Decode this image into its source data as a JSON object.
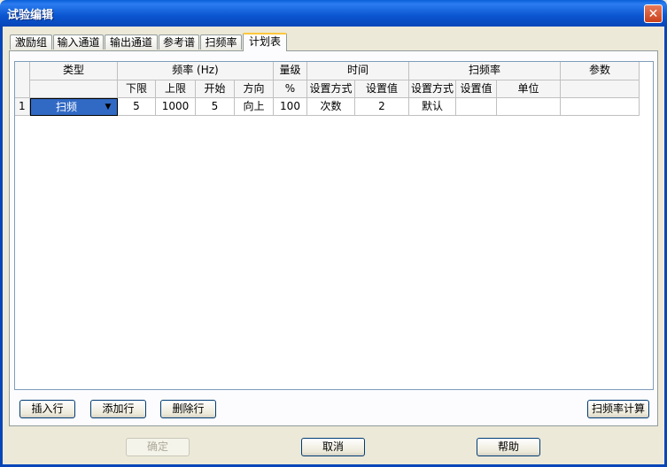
{
  "window": {
    "title": "试验编辑",
    "close_glyph": "✕"
  },
  "tabs": [
    "激励组",
    "输入通道",
    "输出通道",
    "参考谱",
    "扫频率",
    "计划表"
  ],
  "table": {
    "group_headers": {
      "type": "类型",
      "freq": "频率 (Hz)",
      "level": "量级",
      "time": "时间",
      "sweep": "扫频率",
      "params": "参数"
    },
    "sub_headers": {
      "lower": "下限",
      "upper": "上限",
      "start": "开始",
      "direction": "方向",
      "percent": "%",
      "time_mode": "设置方式",
      "time_value": "设置值",
      "sweep_mode": "设置方式",
      "sweep_value": "设置值",
      "unit": "单位"
    },
    "row": {
      "index": "1",
      "type": "扫频",
      "lower": "5",
      "upper": "1000",
      "start": "5",
      "direction": "向上",
      "level": "100",
      "time_mode": "次数",
      "time_value": "2",
      "sweep_mode": "默认",
      "sweep_value": "",
      "unit": "",
      "params": ""
    }
  },
  "buttons": {
    "insert_row": "插入行",
    "add_row": "添加行",
    "delete_row": "删除行",
    "sweep_calc": "扫频率计算",
    "ok": "确定",
    "cancel": "取消",
    "help": "帮助"
  }
}
